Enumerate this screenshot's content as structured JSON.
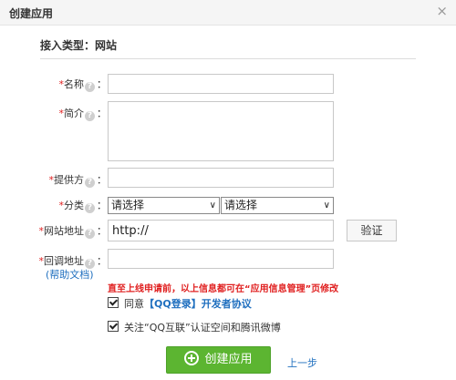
{
  "dialog": {
    "title": "创建应用",
    "close_glyph": "×"
  },
  "section": {
    "title": "接入类型：网站"
  },
  "form": {
    "required_mark": "*",
    "help_glyph": "?",
    "colon": "：",
    "name": {
      "label": "名称",
      "value": ""
    },
    "intro": {
      "label": "简介",
      "value": ""
    },
    "provider": {
      "label": "提供方",
      "value": ""
    },
    "category": {
      "label": "分类",
      "select1": "请选择",
      "select2": "请选择",
      "chevron": "∨"
    },
    "website": {
      "label": "网站地址",
      "value": "http://"
    },
    "callback": {
      "label": "回调地址",
      "value": ""
    },
    "verify_button": "验证",
    "help_doc_link": "(帮助文档)",
    "warning": "直至上线申请前，以上信息都可在“应用信息管理”页修改"
  },
  "agreement": {
    "prefix": "同意",
    "link": "【QQ登录】开发者协议",
    "checked": true
  },
  "follow": {
    "label": "关注“QQ互联”认证空间和腾讯微博",
    "checked": true
  },
  "actions": {
    "create_button": "创建应用",
    "prev_link": "上一步"
  },
  "colors": {
    "primary_green": "#5cb531",
    "link_blue": "#1f6fbf",
    "required_red": "#e02020"
  }
}
